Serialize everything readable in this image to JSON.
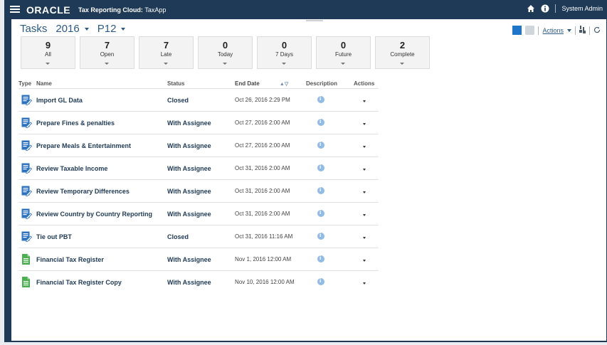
{
  "topbar": {
    "logo": "ORACLE",
    "app_name": "Tax Reporting Cloud:",
    "app_instance": "TaxApp",
    "user": "System Admin"
  },
  "heading": {
    "title": "Tasks",
    "year": "2016",
    "period": "P12"
  },
  "toolbar": {
    "actions_label": "Actions"
  },
  "tiles": [
    {
      "count": "9",
      "label": "All"
    },
    {
      "count": "7",
      "label": "Open"
    },
    {
      "count": "7",
      "label": "Late"
    },
    {
      "count": "0",
      "label": "Today"
    },
    {
      "count": "0",
      "label": "7 Days"
    },
    {
      "count": "0",
      "label": "Future"
    },
    {
      "count": "2",
      "label": "Complete"
    }
  ],
  "table": {
    "headers": {
      "type": "Type",
      "name": "Name",
      "status": "Status",
      "end_date": "End Date",
      "description": "Description",
      "actions": "Actions"
    },
    "rows": [
      {
        "name": "Import GL Data",
        "status": "Closed",
        "end_date": "Oct 26, 2016 2:29 PM",
        "icon": "task-edit-icon"
      },
      {
        "name": "Prepare Fines & penalties",
        "status": "With Assignee",
        "end_date": "Oct 27, 2016 2:00 AM",
        "icon": "task-edit-icon"
      },
      {
        "name": "Prepare Meals & Entertainment",
        "status": "With Assignee",
        "end_date": "Oct 27, 2016 2:00 AM",
        "icon": "task-edit-icon"
      },
      {
        "name": "Review Taxable Income",
        "status": "With Assignee",
        "end_date": "Oct 31, 2016 2:00 AM",
        "icon": "task-edit-icon"
      },
      {
        "name": "Review Temporary Differences",
        "status": "With Assignee",
        "end_date": "Oct 31, 2016 2:00 AM",
        "icon": "task-edit-icon"
      },
      {
        "name": "Review Country by Country Reporting",
        "status": "With Assignee",
        "end_date": "Oct 31, 2016 2:00 AM",
        "icon": "task-edit-icon"
      },
      {
        "name": "Tie out PBT",
        "status": "Closed",
        "end_date": "Oct 31, 2016 11:16 AM",
        "icon": "task-edit-icon"
      },
      {
        "name": "Financial Tax Register",
        "status": "With Assignee",
        "end_date": "Nov 1, 2016 12:00 AM",
        "icon": "document-icon"
      },
      {
        "name": "Financial Tax Register Copy",
        "status": "With Assignee",
        "end_date": "Nov 10, 2016 12:00 AM",
        "icon": "document-icon"
      }
    ]
  },
  "colors": {
    "topbar": "#1f3a56",
    "accent": "#1f75c8",
    "task_icon": "#2f74c0",
    "doc_icon": "#4caf50"
  }
}
